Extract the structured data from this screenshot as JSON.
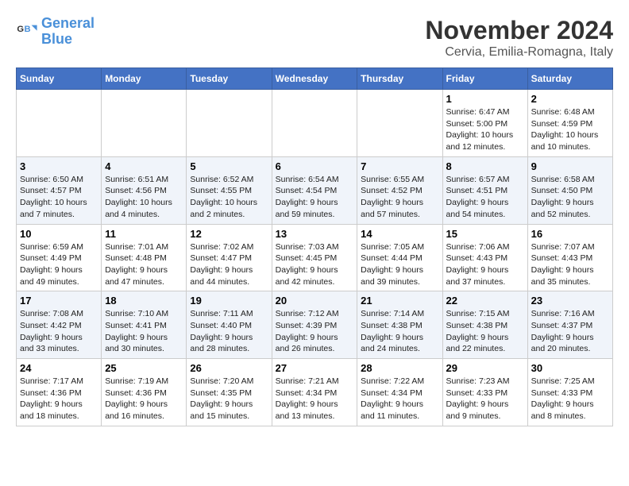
{
  "logo": {
    "line1": "General",
    "line2": "Blue"
  },
  "header": {
    "month": "November 2024",
    "location": "Cervia, Emilia-Romagna, Italy"
  },
  "weekdays": [
    "Sunday",
    "Monday",
    "Tuesday",
    "Wednesday",
    "Thursday",
    "Friday",
    "Saturday"
  ],
  "weeks": [
    [
      {
        "day": "",
        "info": ""
      },
      {
        "day": "",
        "info": ""
      },
      {
        "day": "",
        "info": ""
      },
      {
        "day": "",
        "info": ""
      },
      {
        "day": "",
        "info": ""
      },
      {
        "day": "1",
        "info": "Sunrise: 6:47 AM\nSunset: 5:00 PM\nDaylight: 10 hours and 12 minutes."
      },
      {
        "day": "2",
        "info": "Sunrise: 6:48 AM\nSunset: 4:59 PM\nDaylight: 10 hours and 10 minutes."
      }
    ],
    [
      {
        "day": "3",
        "info": "Sunrise: 6:50 AM\nSunset: 4:57 PM\nDaylight: 10 hours and 7 minutes."
      },
      {
        "day": "4",
        "info": "Sunrise: 6:51 AM\nSunset: 4:56 PM\nDaylight: 10 hours and 4 minutes."
      },
      {
        "day": "5",
        "info": "Sunrise: 6:52 AM\nSunset: 4:55 PM\nDaylight: 10 hours and 2 minutes."
      },
      {
        "day": "6",
        "info": "Sunrise: 6:54 AM\nSunset: 4:54 PM\nDaylight: 9 hours and 59 minutes."
      },
      {
        "day": "7",
        "info": "Sunrise: 6:55 AM\nSunset: 4:52 PM\nDaylight: 9 hours and 57 minutes."
      },
      {
        "day": "8",
        "info": "Sunrise: 6:57 AM\nSunset: 4:51 PM\nDaylight: 9 hours and 54 minutes."
      },
      {
        "day": "9",
        "info": "Sunrise: 6:58 AM\nSunset: 4:50 PM\nDaylight: 9 hours and 52 minutes."
      }
    ],
    [
      {
        "day": "10",
        "info": "Sunrise: 6:59 AM\nSunset: 4:49 PM\nDaylight: 9 hours and 49 minutes."
      },
      {
        "day": "11",
        "info": "Sunrise: 7:01 AM\nSunset: 4:48 PM\nDaylight: 9 hours and 47 minutes."
      },
      {
        "day": "12",
        "info": "Sunrise: 7:02 AM\nSunset: 4:47 PM\nDaylight: 9 hours and 44 minutes."
      },
      {
        "day": "13",
        "info": "Sunrise: 7:03 AM\nSunset: 4:45 PM\nDaylight: 9 hours and 42 minutes."
      },
      {
        "day": "14",
        "info": "Sunrise: 7:05 AM\nSunset: 4:44 PM\nDaylight: 9 hours and 39 minutes."
      },
      {
        "day": "15",
        "info": "Sunrise: 7:06 AM\nSunset: 4:43 PM\nDaylight: 9 hours and 37 minutes."
      },
      {
        "day": "16",
        "info": "Sunrise: 7:07 AM\nSunset: 4:43 PM\nDaylight: 9 hours and 35 minutes."
      }
    ],
    [
      {
        "day": "17",
        "info": "Sunrise: 7:08 AM\nSunset: 4:42 PM\nDaylight: 9 hours and 33 minutes."
      },
      {
        "day": "18",
        "info": "Sunrise: 7:10 AM\nSunset: 4:41 PM\nDaylight: 9 hours and 30 minutes."
      },
      {
        "day": "19",
        "info": "Sunrise: 7:11 AM\nSunset: 4:40 PM\nDaylight: 9 hours and 28 minutes."
      },
      {
        "day": "20",
        "info": "Sunrise: 7:12 AM\nSunset: 4:39 PM\nDaylight: 9 hours and 26 minutes."
      },
      {
        "day": "21",
        "info": "Sunrise: 7:14 AM\nSunset: 4:38 PM\nDaylight: 9 hours and 24 minutes."
      },
      {
        "day": "22",
        "info": "Sunrise: 7:15 AM\nSunset: 4:38 PM\nDaylight: 9 hours and 22 minutes."
      },
      {
        "day": "23",
        "info": "Sunrise: 7:16 AM\nSunset: 4:37 PM\nDaylight: 9 hours and 20 minutes."
      }
    ],
    [
      {
        "day": "24",
        "info": "Sunrise: 7:17 AM\nSunset: 4:36 PM\nDaylight: 9 hours and 18 minutes."
      },
      {
        "day": "25",
        "info": "Sunrise: 7:19 AM\nSunset: 4:36 PM\nDaylight: 9 hours and 16 minutes."
      },
      {
        "day": "26",
        "info": "Sunrise: 7:20 AM\nSunset: 4:35 PM\nDaylight: 9 hours and 15 minutes."
      },
      {
        "day": "27",
        "info": "Sunrise: 7:21 AM\nSunset: 4:34 PM\nDaylight: 9 hours and 13 minutes."
      },
      {
        "day": "28",
        "info": "Sunrise: 7:22 AM\nSunset: 4:34 PM\nDaylight: 9 hours and 11 minutes."
      },
      {
        "day": "29",
        "info": "Sunrise: 7:23 AM\nSunset: 4:33 PM\nDaylight: 9 hours and 9 minutes."
      },
      {
        "day": "30",
        "info": "Sunrise: 7:25 AM\nSunset: 4:33 PM\nDaylight: 9 hours and 8 minutes."
      }
    ]
  ]
}
